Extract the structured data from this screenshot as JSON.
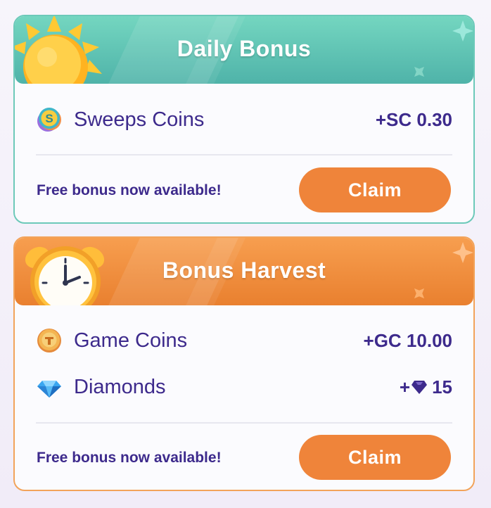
{
  "daily_bonus": {
    "title": "Daily Bonus",
    "icon": "sun-icon",
    "items": [
      {
        "icon": "sweeps-coin-icon",
        "label": "Sweeps Coins",
        "value": "+SC 0.30"
      }
    ],
    "status_text": "Free bonus now available!",
    "claim_label": "Claim",
    "accent_color": "#5cc2b3"
  },
  "bonus_harvest": {
    "title": "Bonus Harvest",
    "icon": "alarm-clock-icon",
    "items": [
      {
        "icon": "game-coin-icon",
        "label": "Game Coins",
        "value": "+GC 10.00"
      },
      {
        "icon": "diamond-icon",
        "label": "Diamonds",
        "value_prefix": "+",
        "value_icon": "diamond-icon",
        "value": "15"
      }
    ],
    "status_text": "Free bonus now available!",
    "claim_label": "Claim",
    "accent_color": "#ef843a"
  },
  "colors": {
    "text_primary": "#3d2a8c",
    "claim_button": "#ef843a"
  }
}
